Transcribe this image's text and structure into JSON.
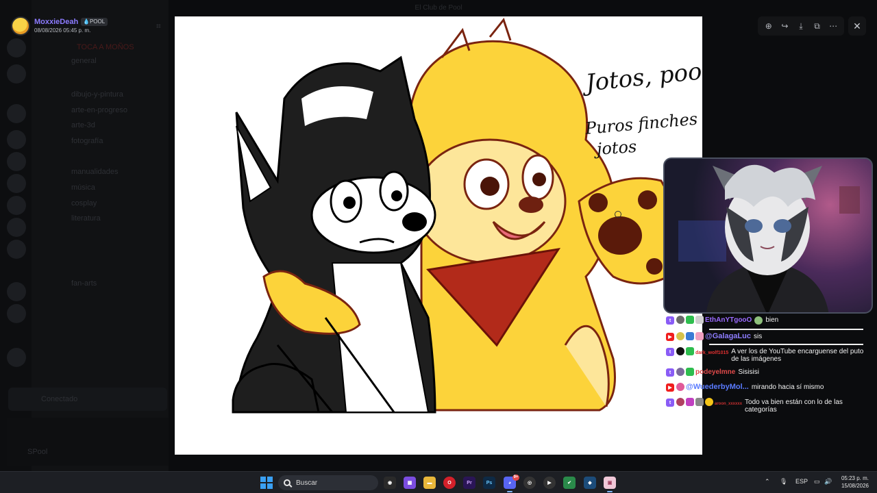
{
  "window": {
    "title": "El Club de Pool"
  },
  "background": {
    "channels": [
      "general",
      "dibujo-y-pintura",
      "arte-en-progreso",
      "arte-3d",
      "fotografía",
      "manualidades",
      "música",
      "cosplay",
      "literatura",
      "fan-arts"
    ],
    "hot_label": "TOCA A MOÑOS",
    "voice_label": "Conectado",
    "user_name": "SPool"
  },
  "viewer": {
    "author": "MoxxieDeah",
    "badge": "POOL",
    "timestamp": "08/08/2026 05:45 p. m.",
    "toolbar": [
      {
        "name": "zoom-icon",
        "glyph": "⊕"
      },
      {
        "name": "forward-icon",
        "glyph": "↪"
      },
      {
        "name": "download-icon",
        "glyph": "⤓"
      },
      {
        "name": "open-external-icon",
        "glyph": "⧉"
      },
      {
        "name": "more-icon",
        "glyph": "⋯"
      }
    ],
    "close_glyph": "✕"
  },
  "image": {
    "caption_line1": "Jotos, pool",
    "caption_line2": "Puros finches",
    "caption_line3": "jotos"
  },
  "chat": [
    {
      "platform": "tw",
      "user": "EthAnYTgooO",
      "user_color": "#9b6bff",
      "text": "bien",
      "badges": [
        "#6a6a6a",
        "#2ebd4e",
        "#cfcfcf"
      ],
      "trailing": "#8ec07c"
    },
    {
      "platform": "yt",
      "user": "@GalagaLuc",
      "user_color": "#8e7dff",
      "text": "sis",
      "badges": [
        "#d6c24a",
        "#3a7bd5",
        "#f0a0c0"
      ]
    },
    {
      "platform": "tw",
      "user": "dark_wolf1015",
      "user_color": "#e03030",
      "text": "A ver los de YouTube encarguense del puto de las imágenes",
      "badges": [
        "#111111",
        "#2ebd4e"
      ],
      "small": true
    },
    {
      "platform": "tw",
      "user": "podeyelmne",
      "user_color": "#e04a4a",
      "text": "Sisisisi",
      "badges": [
        "#7a6a9a",
        "#2ebd4e"
      ]
    },
    {
      "platform": "yt",
      "user": "@WuederbyMol...",
      "user_color": "#5a7bff",
      "text": "mirando hacia sí mismo",
      "badges": [
        "#e05a9a"
      ]
    },
    {
      "platform": "tw",
      "user": "aroon_xxxxxx",
      "user_color": "#c83030",
      "text": "Todo va bien están con lo de las categorías",
      "badges": [
        "#b04060",
        "#c040c0",
        "#888888",
        "#f5c518"
      ],
      "small": true
    }
  ],
  "taskbar": {
    "search_label": "Buscar",
    "apps": [
      {
        "name": "obs-icon",
        "color": "#2a2a2a",
        "glyph": "◉"
      },
      {
        "name": "app-grid-icon",
        "color": "#7b4de0",
        "glyph": "▦"
      },
      {
        "name": "explorer-icon",
        "color": "#e9b73a",
        "glyph": "▬"
      },
      {
        "name": "opera-icon",
        "color": "#d4202a",
        "glyph": "O"
      },
      {
        "name": "premiere-icon",
        "color": "#2a1556",
        "glyph": "Pr"
      },
      {
        "name": "photoshop-icon",
        "color": "#0e2a45",
        "glyph": "Ps"
      },
      {
        "name": "discord-icon",
        "color": "#5865f2",
        "glyph": "◕",
        "badge": "9+",
        "active": true
      },
      {
        "name": "chrome-like-icon",
        "color": "#333",
        "glyph": "◎"
      },
      {
        "name": "media-player-icon",
        "color": "#333",
        "glyph": "▶"
      },
      {
        "name": "task-app-icon",
        "color": "#2a8a4a",
        "glyph": "✔"
      },
      {
        "name": "streamlabs-icon",
        "color": "#1c4c7a",
        "glyph": "◆"
      },
      {
        "name": "image-viewer-icon",
        "color": "#f0c8d8",
        "glyph": "▣"
      }
    ],
    "language": "ESP",
    "time": "05:23 p. m.",
    "date": "15/08/2026"
  }
}
